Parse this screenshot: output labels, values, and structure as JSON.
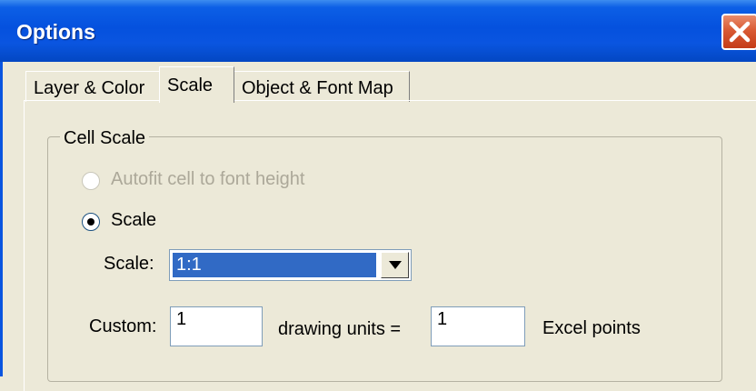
{
  "window": {
    "title": "Options",
    "close_icon": "close-x-icon"
  },
  "tabs": [
    {
      "label": "Layer & Color",
      "active": false
    },
    {
      "label": "Scale",
      "active": true
    },
    {
      "label": "Object & Font Map",
      "active": false
    }
  ],
  "cell_scale": {
    "group_label": "Cell Scale",
    "autofit": {
      "label": "Autofit cell to font height",
      "enabled": false,
      "selected": false
    },
    "scale_option": {
      "label": "Scale",
      "enabled": true,
      "selected": true
    },
    "scale_select": {
      "label": "Scale:",
      "value": "1:1"
    },
    "custom": {
      "label": "Custom:",
      "drawing_units_value": "1",
      "drawing_units_label": "drawing units =",
      "excel_points_value": "1",
      "excel_points_label": "Excel points"
    }
  }
}
